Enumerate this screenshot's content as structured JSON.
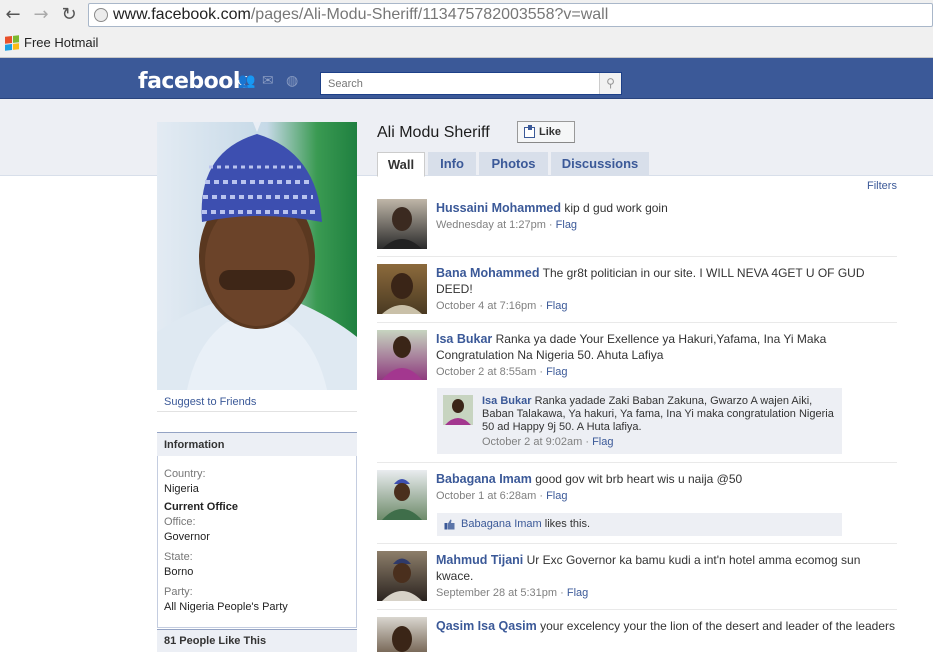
{
  "browser": {
    "url_host": "www.facebook.com",
    "url_path": "/pages/Ali-Modu-Sheriff/113475782003558?v=wall",
    "bookmark": "Free Hotmail"
  },
  "fb": {
    "logo": "facebook",
    "search_placeholder": "Search"
  },
  "page": {
    "title": "Ali Modu Sheriff",
    "like_label": "Like",
    "tabs": [
      "Wall",
      "Info",
      "Photos",
      "Discussions"
    ],
    "filters": "Filters"
  },
  "sidebar": {
    "suggest": "Suggest to Friends",
    "info_title": "Information",
    "country_label": "Country:",
    "country": "Nigeria",
    "current_office": "Current Office",
    "office_label": "Office:",
    "office": "Governor",
    "state_label": "State:",
    "state": "Borno",
    "party_label": "Party:",
    "party": "All Nigeria People's Party",
    "likes_title": "81 People Like This"
  },
  "posts": [
    {
      "name": "Hussaini Mohammed",
      "text": "kip d gud work goin",
      "time": "Wednesday at 1:27pm",
      "flag": "Flag"
    },
    {
      "name": "Bana Mohammed",
      "text": "The gr8t politician in our site. I WILL NEVA 4GET U OF GUD DEED!",
      "time": "October 4 at 7:16pm",
      "flag": "Flag"
    },
    {
      "name": "Isa Bukar",
      "text": "Ranka ya dade Your Exellence ya Hakuri,Yafama, Ina Yi Maka Congratulation Na Nigeria 50. Ahuta Lafiya",
      "time": "October 2 at 8:55am",
      "flag": "Flag"
    },
    {
      "name": "Babagana Imam",
      "text": "good gov wit brb heart wis u naija @50",
      "time": "October 1 at 6:28am",
      "flag": "Flag"
    },
    {
      "name": "Mahmud Tijani",
      "text": "Ur Exc Governor ka bamu kudi a int'n hotel amma ecomog sun kwace.",
      "time": "September 28 at 5:31pm",
      "flag": "Flag"
    },
    {
      "name": "Qasim Isa Qasim",
      "text": "your excelency your the lion of the desert and leader of the leaders"
    }
  ],
  "reply": {
    "name": "Isa Bukar",
    "text": "Ranka yadade Zaki Baban Zakuna, Gwarzo A wajen Aiki, Baban Talakawa, Ya hakuri, Ya fama, Ina Yi maka congratulation Nigeria 50 ad Happy 9j 50. A Huta lafiya.",
    "time": "October 2 at 9:02am",
    "flag": "Flag"
  },
  "likes_line": {
    "name": "Babagana Imam",
    "suffix": " likes this."
  },
  "meta_sep": " · "
}
